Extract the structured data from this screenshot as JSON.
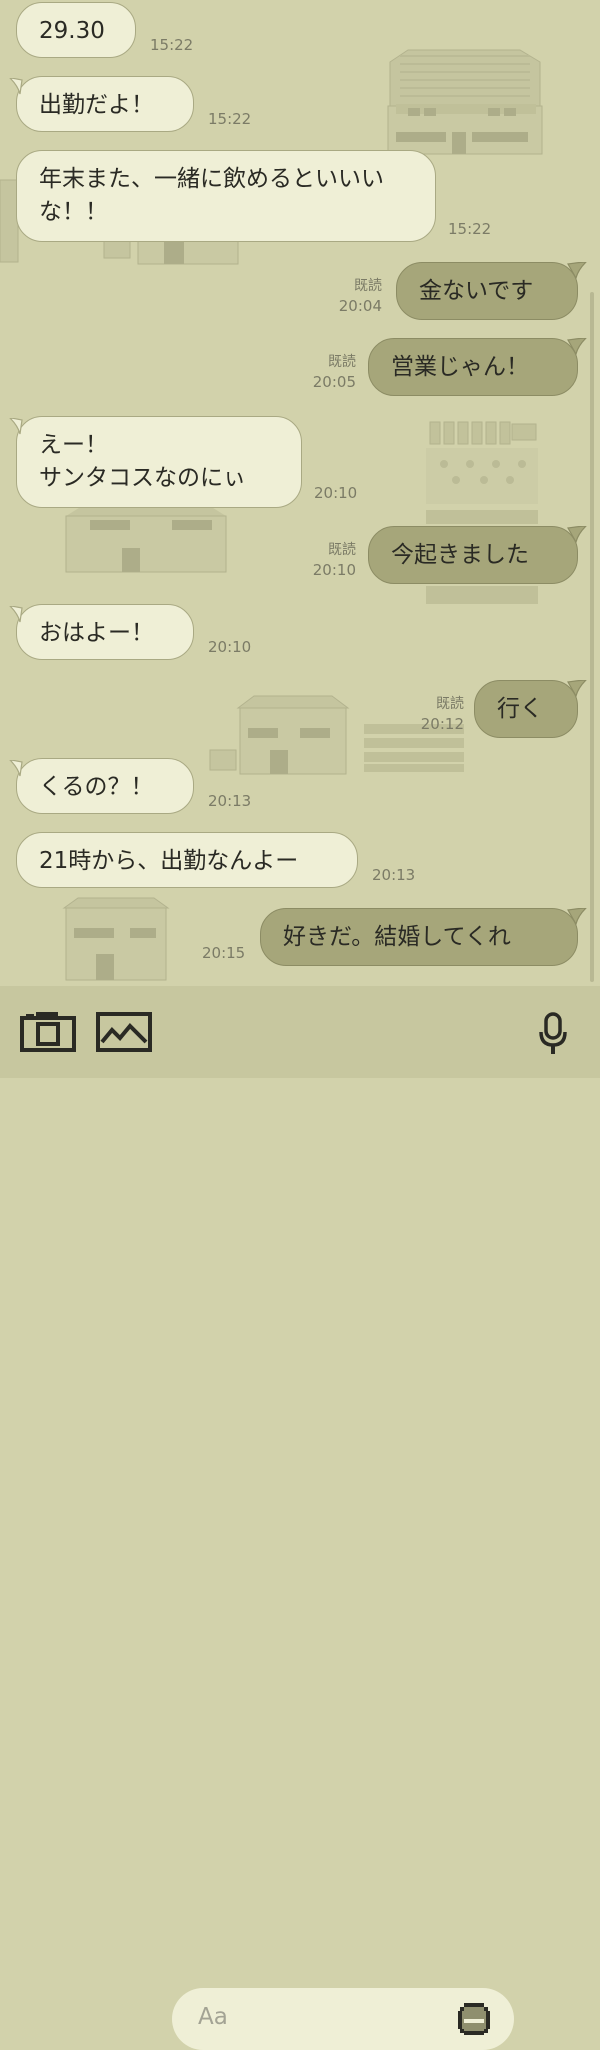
{
  "colors": {
    "background": "#d2d2ab",
    "incoming_bubble": "#efefd6",
    "outgoing_bubble": "#a6a67a",
    "input_bar": "#c7c79f"
  },
  "messages": [
    {
      "id": "m1",
      "side": "in",
      "text": "29.30",
      "time": "15:22"
    },
    {
      "id": "m2",
      "side": "in",
      "text": "出勤だよ！",
      "time": "15:22"
    },
    {
      "id": "m3",
      "side": "in",
      "lines": [
        "年末また、一緒に飲めるといいい",
        "な！！"
      ],
      "time": "15:22"
    },
    {
      "id": "m4",
      "side": "out",
      "text": "金ないです",
      "read": "既読",
      "time": "20:04"
    },
    {
      "id": "m5",
      "side": "out",
      "text": "営業じゃん！",
      "read": "既読",
      "time": "20:05"
    },
    {
      "id": "m6",
      "side": "in",
      "lines": [
        "えー！",
        "サンタコスなのにぃ"
      ],
      "time": "20:10"
    },
    {
      "id": "m7",
      "side": "out",
      "text": "今起きました",
      "read": "既読",
      "time": "20:10"
    },
    {
      "id": "m8",
      "side": "in",
      "text": "おはよー！",
      "time": "20:10"
    },
    {
      "id": "m9",
      "side": "out",
      "text": "行く",
      "read": "既読",
      "time": "20:12"
    },
    {
      "id": "m10",
      "side": "in",
      "text": "くるの？！",
      "time": "20:13"
    },
    {
      "id": "m11",
      "side": "in",
      "text": "21時から、出勤なんよー",
      "time": "20:13"
    },
    {
      "id": "m12",
      "side": "out",
      "text": "好きだ。結婚してくれ",
      "time": "20:15"
    }
  ],
  "input": {
    "placeholder": "Aa",
    "icons": [
      "camera-icon",
      "image-icon",
      "emoji-icon",
      "microphone-icon"
    ]
  }
}
